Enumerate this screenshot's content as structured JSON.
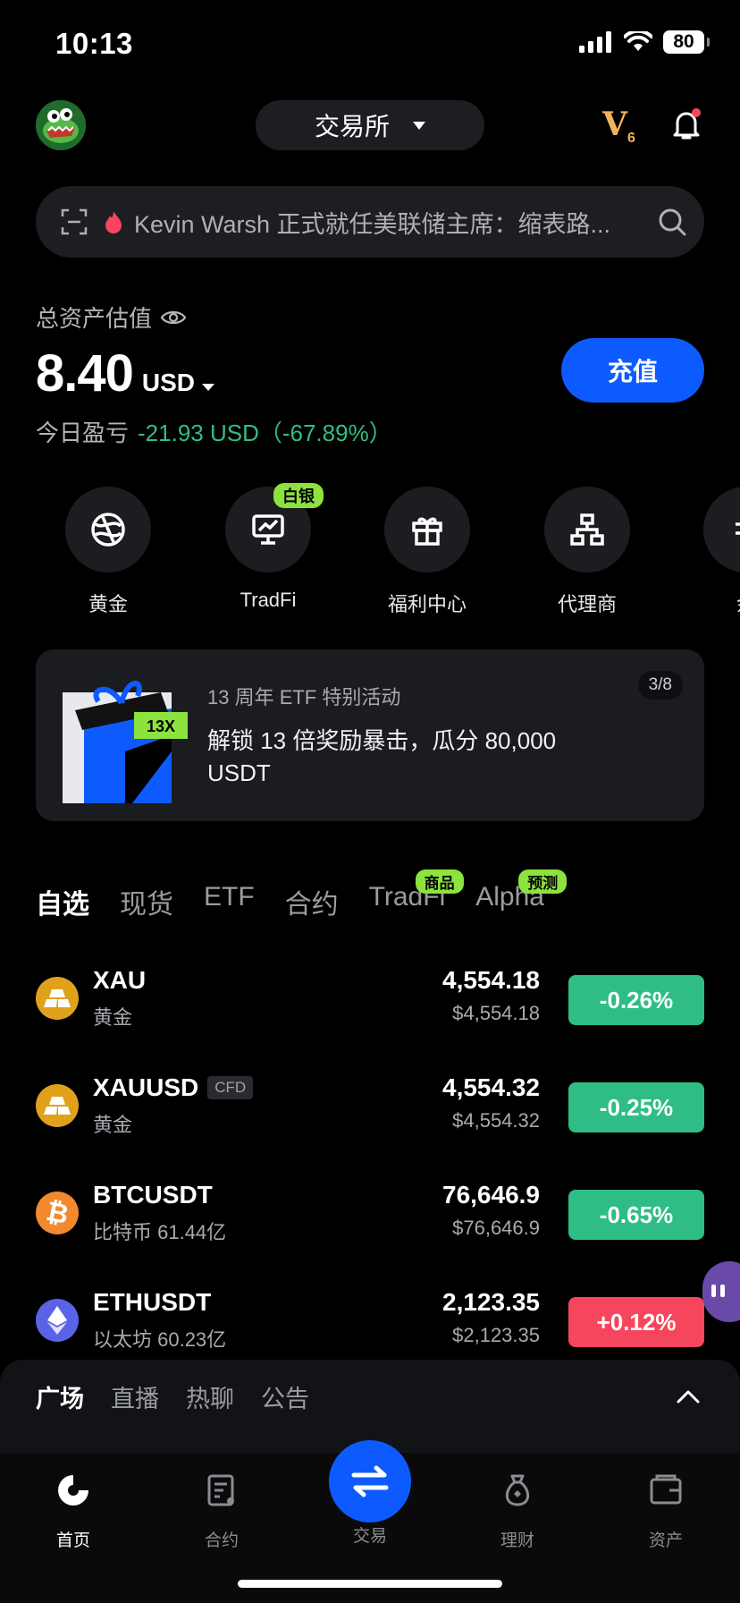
{
  "status": {
    "time": "10:13",
    "battery": "80"
  },
  "header": {
    "exchange_label": "交易所",
    "vip_level": "V",
    "vip_sub": "6"
  },
  "search": {
    "text": "Kevin Warsh 正式就任美联储主席：缩表路..."
  },
  "assets": {
    "label": "总资产估值",
    "value": "8.40",
    "unit": "USD",
    "pnl_label": "今日盈亏",
    "pnl_value": "-21.93 USD（-67.89%）",
    "deposit_label": "充值"
  },
  "quick_menu": [
    {
      "label": "黄金",
      "icon": "gold-globe-icon",
      "badge": ""
    },
    {
      "label": "TradFi",
      "icon": "tradfi-chart-icon",
      "badge": "白银"
    },
    {
      "label": "福利中心",
      "icon": "gift-icon",
      "badge": ""
    },
    {
      "label": "代理商",
      "icon": "org-chart-icon",
      "badge": ""
    },
    {
      "label": "余",
      "icon": "wealth-icon",
      "badge": ""
    }
  ],
  "banner": {
    "subtitle": "13 周年 ETF 特别活动",
    "title": "解锁 13 倍奖励暴击，瓜分 80,000 USDT",
    "art_badge": "13X",
    "page": "3/8"
  },
  "tabs": [
    {
      "label": "自选",
      "active": true,
      "badge": ""
    },
    {
      "label": "现货",
      "active": false,
      "badge": ""
    },
    {
      "label": "ETF",
      "active": false,
      "badge": ""
    },
    {
      "label": "合约",
      "active": false,
      "badge": ""
    },
    {
      "label": "TradFi",
      "active": false,
      "badge": "商品"
    },
    {
      "label": "Alpha",
      "active": false,
      "badge": "预测"
    }
  ],
  "markets": [
    {
      "symbol": "XAU",
      "tag": "",
      "name": "黄金",
      "price": "4,554.18",
      "price_usd": "$4,554.18",
      "change": "-0.26%",
      "direction": "green",
      "icon": "gold-bar-icon",
      "icon_color": "#e0a21b"
    },
    {
      "symbol": "XAUUSD",
      "tag": "CFD",
      "name": "黄金",
      "price": "4,554.32",
      "price_usd": "$4,554.32",
      "change": "-0.25%",
      "direction": "green",
      "icon": "gold-bar-icon",
      "icon_color": "#e0a21b"
    },
    {
      "symbol": "BTCUSDT",
      "tag": "",
      "name": "比特币 61.44亿",
      "price": "76,646.9",
      "price_usd": "$76,646.9",
      "change": "-0.65%",
      "direction": "green",
      "icon": "bitcoin-icon",
      "icon_color": "#f2892e"
    },
    {
      "symbol": "ETHUSDT",
      "tag": "",
      "name": "以太坊 60.23亿",
      "price": "2,123.35",
      "price_usd": "$2,123.35",
      "change": "+0.12%",
      "direction": "red",
      "icon": "ethereum-icon",
      "icon_color": "#5a63e6"
    }
  ],
  "community": {
    "tabs": [
      "广场",
      "直播",
      "热聊",
      "公告"
    ]
  },
  "nav": {
    "home": "首页",
    "futures": "合约",
    "trade": "交易",
    "earn": "理财",
    "assets": "资产"
  },
  "colors": {
    "accent": "#0d5bff",
    "up_green": "#2ebd85",
    "down_red": "#f6465d",
    "badge_green": "#8ce33d"
  }
}
